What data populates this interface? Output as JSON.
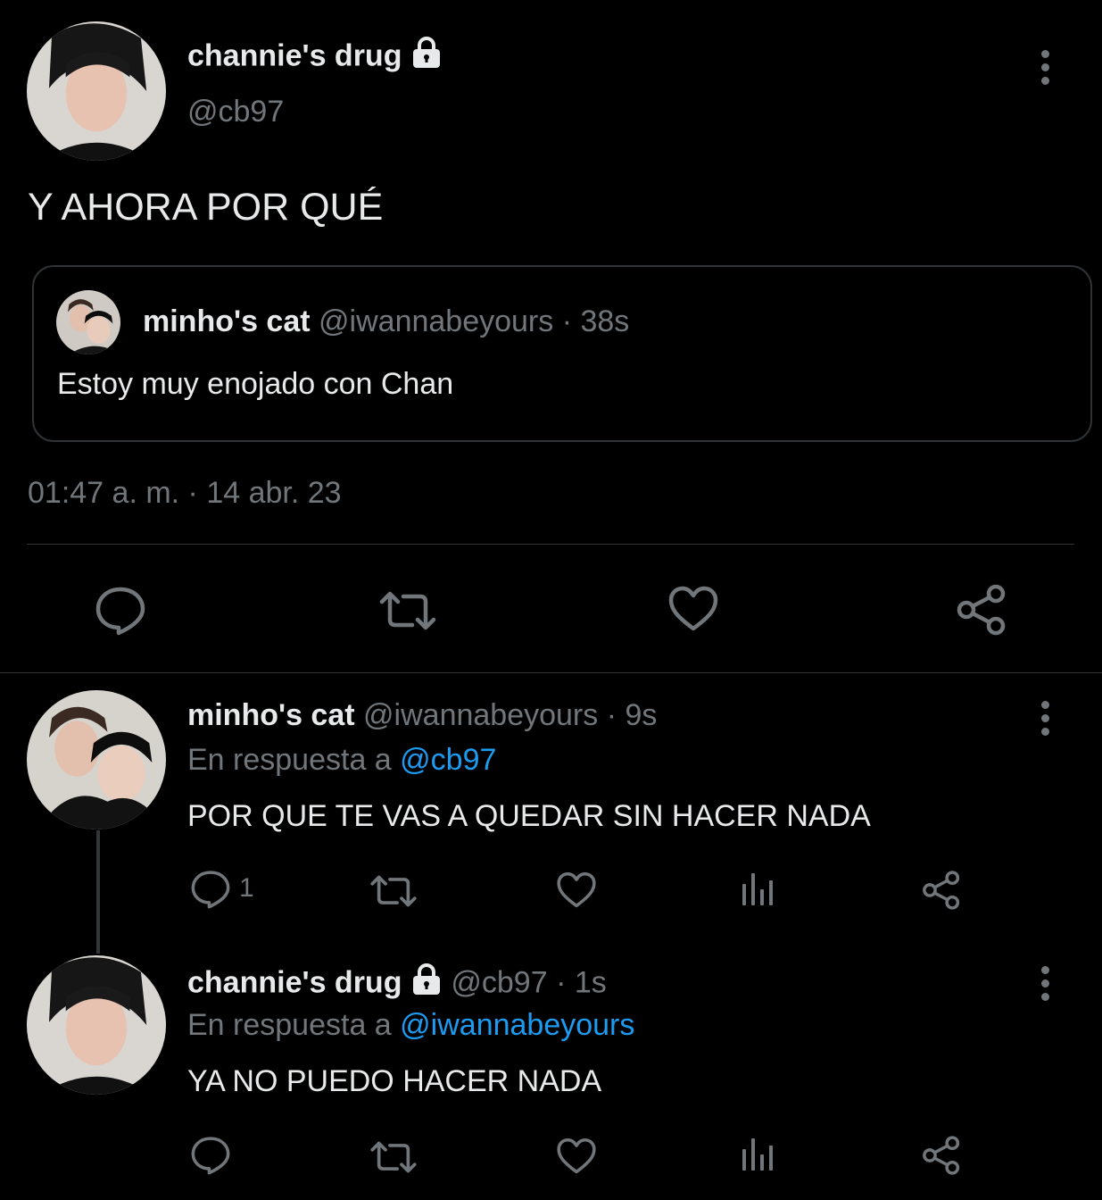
{
  "main_tweet": {
    "display_name": "channie's drug",
    "handle": "@cb97",
    "text": "Y AHORA POR QUÉ",
    "timestamp": "01:47 a. m. · 14 abr. 23"
  },
  "quoted_tweet": {
    "display_name": "minho's cat",
    "handle": "@iwannabeyours",
    "time": " · 38s",
    "text": "Estoy muy enojado con Chan"
  },
  "reply_1": {
    "display_name": "minho's cat",
    "handle": "@iwannabeyours",
    "time": " · 9s",
    "reply_prefix": "En respuesta a ",
    "reply_to": "@cb97",
    "text": "POR QUE TE VAS A QUEDAR SIN HACER NADA",
    "reply_count": "1"
  },
  "reply_2": {
    "display_name": "channie's drug",
    "handle": "@cb97",
    "time": " · 1s",
    "reply_prefix": "En respuesta a ",
    "reply_to": "@iwannabeyours",
    "text": "YA NO PUEDO HACER NADA"
  },
  "icons": {
    "reply": "reply-icon",
    "retweet": "retweet-icon",
    "like": "heart-icon",
    "views": "views-icon",
    "share": "share-icon",
    "more": "more-icon",
    "lock": "lock-icon"
  },
  "colors": {
    "background": "#000000",
    "text": "#e7e9ea",
    "muted": "#71767b",
    "link": "#1d9bf0",
    "border": "#2f3336"
  }
}
